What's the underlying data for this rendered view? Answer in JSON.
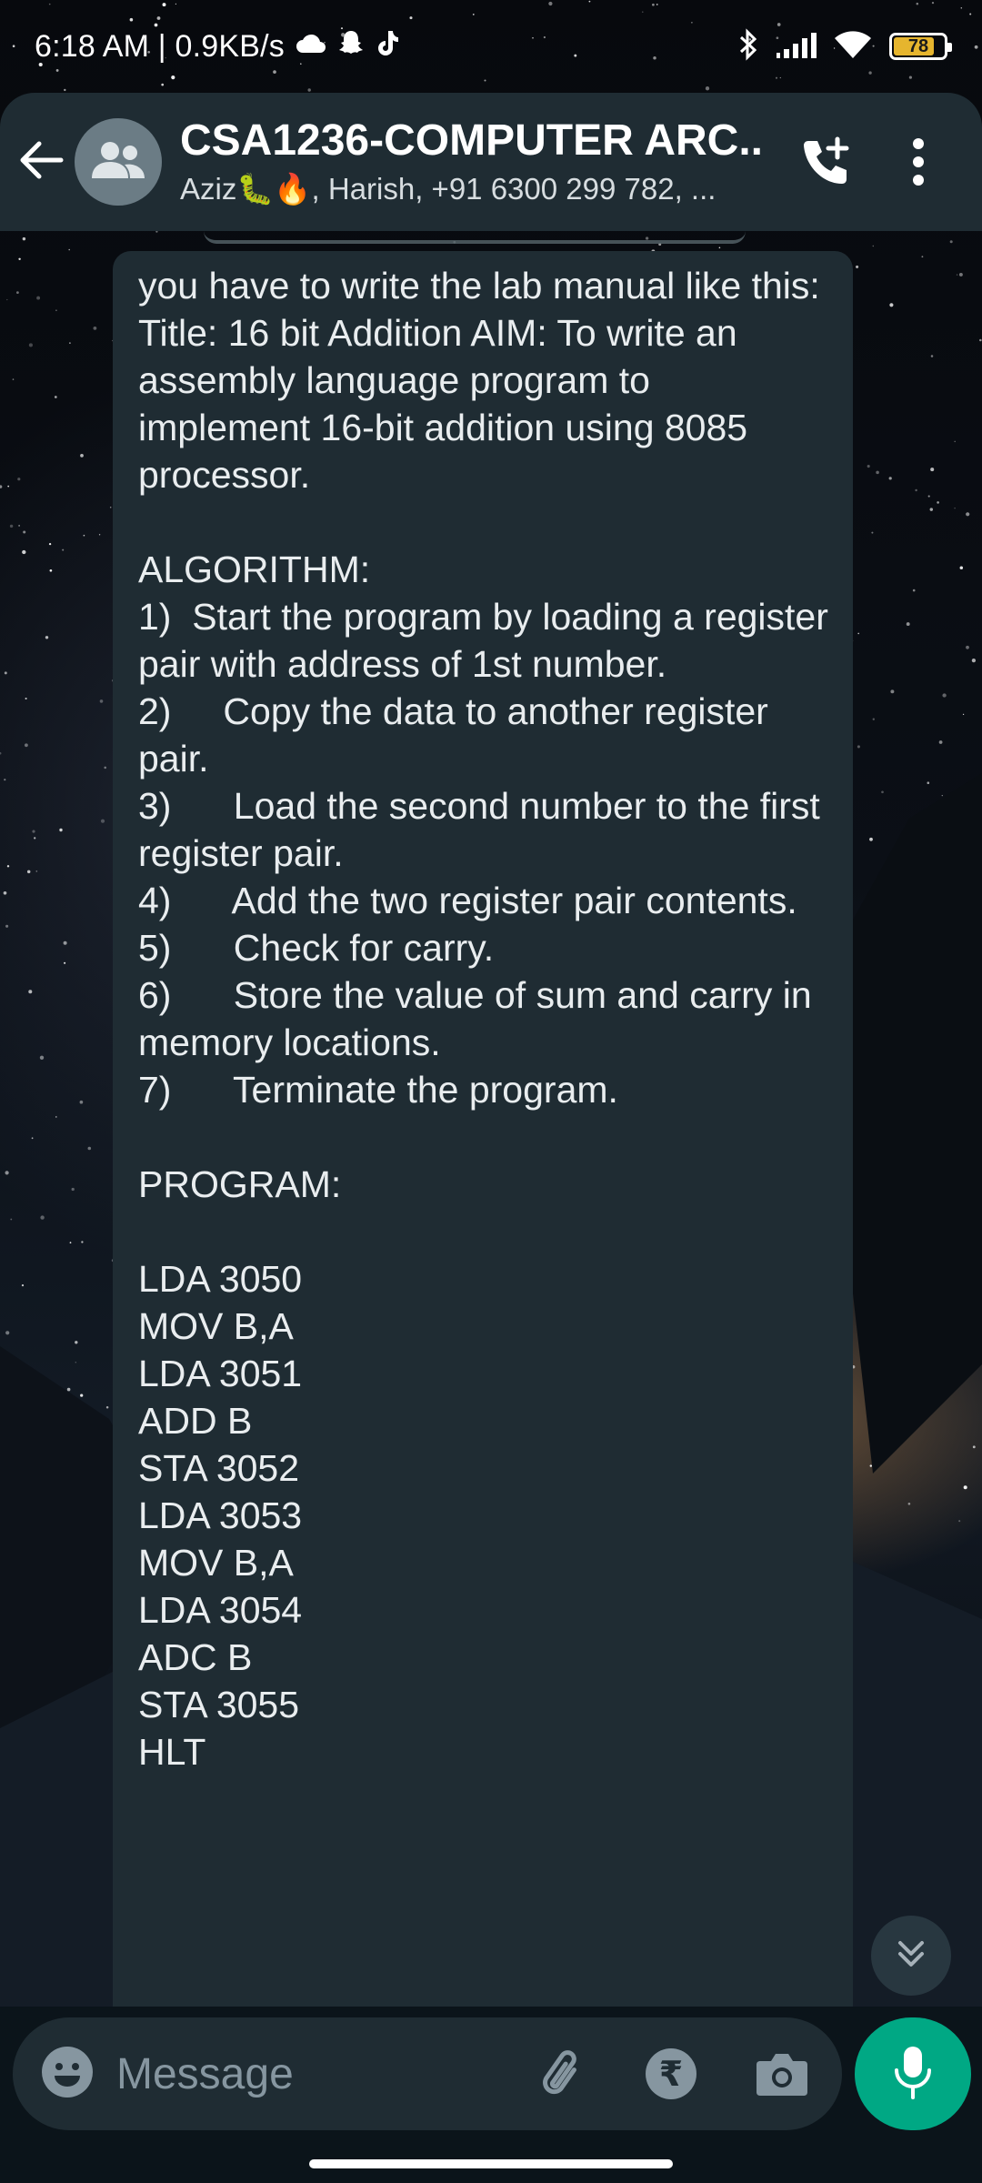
{
  "status_bar": {
    "time": "6:18 AM",
    "speed": "0.9KB/s",
    "separator": " | ",
    "battery": "78",
    "icons": [
      "cloud-icon",
      "snapchat-icon",
      "tiktok-icon",
      "bluetooth-icon",
      "signal-icon",
      "wifi-icon",
      "battery-icon"
    ]
  },
  "header": {
    "title": "CSA1236-COMPUTER ARC...",
    "members": "Aziz🐛🔥, Harish, +91 6300 299 782, ...",
    "icons": [
      "back-arrow-icon",
      "group-avatar-icon",
      "add-call-icon",
      "more-vert-icon"
    ]
  },
  "message": {
    "text": "you have to write the lab manual like this: Title: 16 bit Addition AIM: To write an assembly language program to implement 16-bit addition using 8085 processor.\n\nALGORITHM:\n1)  Start the program by loading a register pair with address of 1st number.\n2)     Copy the data to another register pair.\n3)      Load the second number to the first register pair.\n4)      Add the two register pair contents.\n5)      Check for carry.\n6)      Store the value of sum and carry in memory locations.\n7)      Terminate the program.\n\nPROGRAM:\n\nLDA 3050\nMOV B,A\nLDA 3051\nADD B\nSTA 3052\nLDA 3053\nMOV B,A\nLDA 3054\nADC B\nSTA 3055\nHLT"
  },
  "composer": {
    "placeholder": "Message",
    "rupee_symbol": "₹",
    "icons": [
      "emoji-icon",
      "attach-icon",
      "rupee-icon",
      "camera-icon",
      "mic-icon",
      "scroll-down-icon"
    ]
  },
  "colors": {
    "bar": "#1f2c33",
    "bubble": "#1f2c33",
    "text": "#e9edef",
    "muted": "#8696a0",
    "accent": "#00a884",
    "battery": "#e6b52e"
  }
}
